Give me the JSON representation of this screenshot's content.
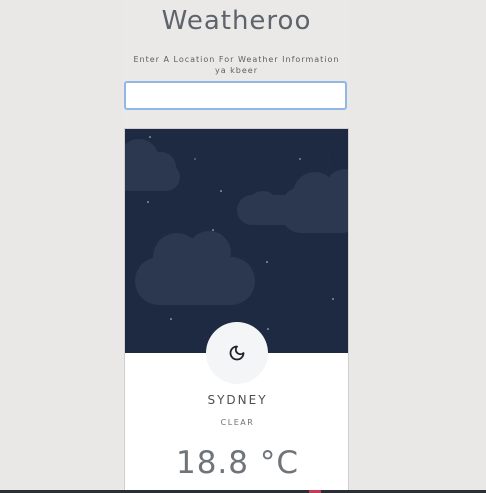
{
  "app": {
    "title": "Weatheroo",
    "prompt_line1": "Enter A Location For Weather Information",
    "prompt_line2": "ya kbeer"
  },
  "search": {
    "value": "",
    "placeholder": ""
  },
  "weather": {
    "city": "SYDNEY",
    "condition": "CLEAR",
    "temperature": "18.8 °C",
    "scene": "night-clear-with-crescent-moon-and-clouds",
    "badge_icon": "moon-icon"
  },
  "colors": {
    "page_background": "#e9e8e7",
    "night_sky": "#1e2a42",
    "moon": "#f2c94c",
    "input_focus_border": "#8fb8e6",
    "title_text": "#5d646b"
  }
}
